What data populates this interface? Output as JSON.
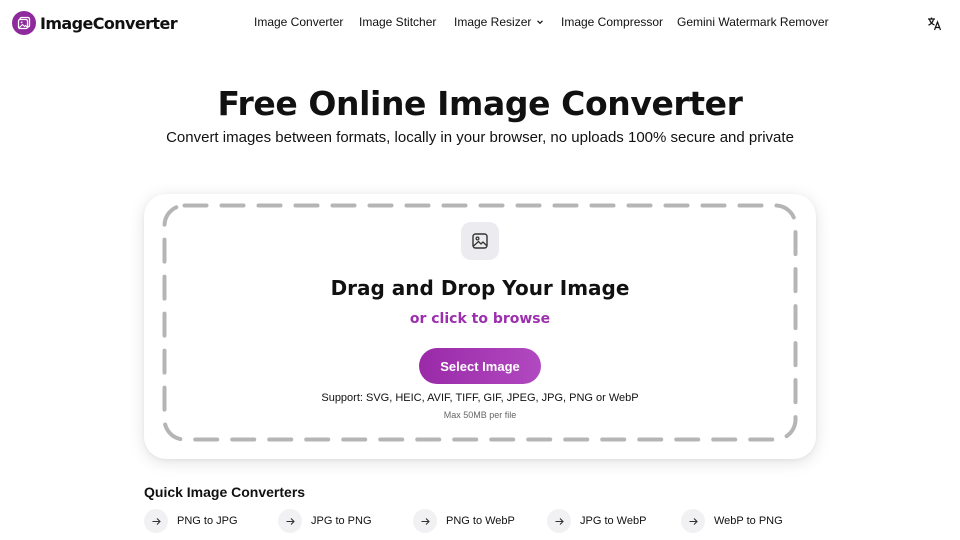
{
  "header": {
    "logo_text": "ImageConverter",
    "nav": [
      {
        "label": "Image Converter"
      },
      {
        "label": "Image Stitcher"
      },
      {
        "label": "Image Resizer"
      },
      {
        "label": "Image Compressor"
      },
      {
        "label": "Gemini Watermark Remover"
      }
    ],
    "language_icon": "translate-icon"
  },
  "hero": {
    "title": "Free Online Image Converter",
    "subtitle": "Convert images between formats, locally in your browser, no uploads 100% secure and private"
  },
  "upload": {
    "icon": "image-icon",
    "title": "Drag and Drop Your Image",
    "browse_link": "or click to browse",
    "button_label": "Select Image",
    "support_text": "Support: SVG, HEIC, AVIF, TIFF, GIF, JPEG, JPG, PNG or WebP",
    "max_size": "Max 50MB per file"
  },
  "quick": {
    "title": "Quick Image Converters",
    "items": [
      {
        "label": "PNG to JPG"
      },
      {
        "label": "JPG to PNG"
      },
      {
        "label": "PNG to WebP"
      },
      {
        "label": "JPG to WebP"
      },
      {
        "label": "WebP to PNG"
      }
    ]
  },
  "colors": {
    "accent": "#9b2fae",
    "button_gradient_start": "#9a2aa8",
    "button_gradient_end": "#b149c0",
    "dash": "#b5b5b5"
  }
}
